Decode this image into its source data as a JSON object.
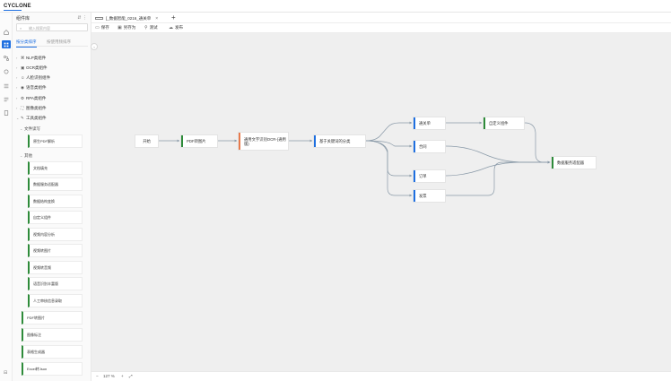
{
  "app": {
    "logo_text": "CYCLONE"
  },
  "rail": {
    "icons": [
      "home-icon",
      "grid-icon",
      "flow-icon",
      "component-icon",
      "list-icon",
      "book-icon",
      "settings-icon"
    ]
  },
  "sidebar": {
    "title": "组件库",
    "tools": "⇵ ⋮",
    "search_placeholder": "输入搜索内容",
    "tabs": [
      "按分类排序",
      "按使用频排序"
    ],
    "categories": [
      {
        "label": "NLP类组件",
        "icon": "nlp-icon"
      },
      {
        "label": "OCR类组件",
        "icon": "ocr-icon"
      },
      {
        "label": "人脸识别组件",
        "icon": "face-icon"
      },
      {
        "label": "语音类组件",
        "icon": "voice-icon"
      },
      {
        "label": "RPA类组件",
        "icon": "rpa-icon"
      },
      {
        "label": "图像类组件",
        "icon": "image-icon"
      },
      {
        "label": "工具类组件",
        "icon": "tool-icon"
      }
    ],
    "sub_file": "文件读写",
    "file_cards": [
      "原生PDF解析"
    ],
    "sub_other": "其他",
    "other_cards": [
      "文档填充",
      "数据服务适配器",
      "数据结构变换",
      "自定义组件",
      "视频内容分析",
      "视频转图片",
      "视频转音频",
      "语音识别丰富版",
      "人工审核信息录取"
    ],
    "bottom_cards": [
      "PDF转图片",
      "图像标注",
      "表格生成器",
      "Excel转Json"
    ]
  },
  "tabsbar": {
    "tab_label": "[_数据智能_0216_通关单",
    "close": "×",
    "add": "+"
  },
  "toolbar": {
    "items": [
      {
        "label": "保存",
        "icon": "save-icon",
        "glyph": "▭"
      },
      {
        "label": "另存为",
        "icon": "save-as-icon",
        "glyph": "▣"
      },
      {
        "label": "测试",
        "icon": "test-icon",
        "glyph": "⚲"
      },
      {
        "label": "发布",
        "icon": "cloud-icon",
        "glyph": "☁"
      }
    ]
  },
  "canvas": {
    "nodes": [
      {
        "id": "start",
        "label": "开始",
        "color": "none"
      },
      {
        "id": "pdf",
        "label": "PDF转图片",
        "color": "green"
      },
      {
        "id": "ocr",
        "label": "通用文字识别OCR-(通用版)",
        "color": "orange"
      },
      {
        "id": "cls",
        "label": "基于关键词的分类",
        "color": "blue"
      },
      {
        "id": "tgd",
        "label": "通关单",
        "color": "blue"
      },
      {
        "id": "custom",
        "label": "自定义组件",
        "color": "green"
      },
      {
        "id": "contract",
        "label": "合同",
        "color": "blue"
      },
      {
        "id": "order",
        "label": "订单",
        "color": "blue"
      },
      {
        "id": "invoice",
        "label": "发票",
        "color": "blue"
      },
      {
        "id": "adapter",
        "label": "数据服务适配器",
        "color": "green"
      }
    ]
  },
  "footer": {
    "zoom": "127 %",
    "minus": "−",
    "plus": "+",
    "fit_icon": "⤢"
  },
  "colors": {
    "accent": "#1e6fe0",
    "green": "#2e8b3a",
    "orange": "#e87a4c",
    "edge": "#8a9aa8"
  }
}
